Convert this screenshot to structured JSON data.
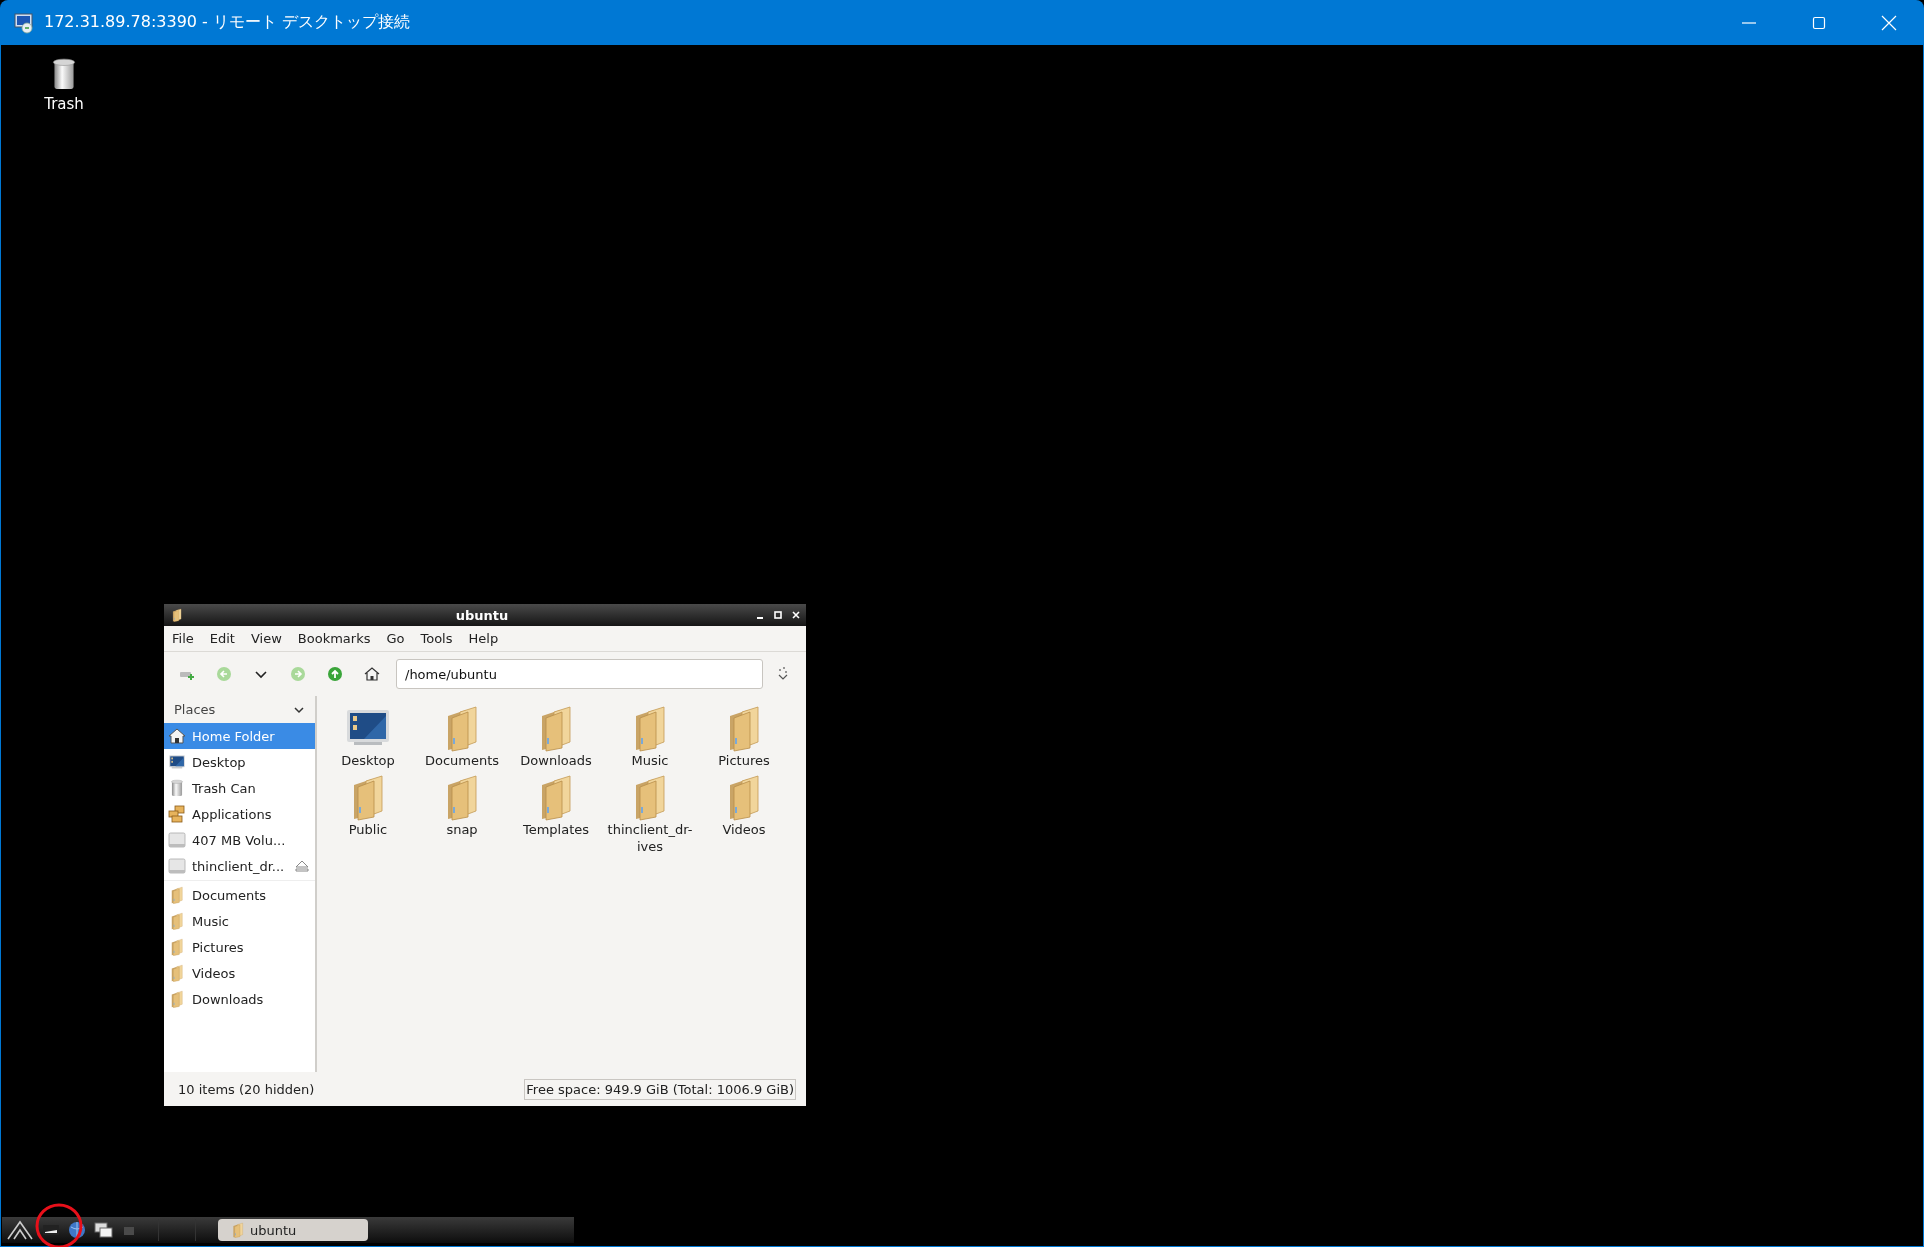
{
  "remote_window": {
    "title": "172.31.89.78:3390 - リモート デスクトップ接続"
  },
  "desktop_icons": [
    {
      "label": "Trash",
      "kind": "trash"
    }
  ],
  "file_manager": {
    "title": "ubuntu",
    "menu": [
      "File",
      "Edit",
      "View",
      "Bookmarks",
      "Go",
      "Tools",
      "Help"
    ],
    "location": "/home/ubuntu",
    "places": {
      "header": "Places",
      "devices": [
        {
          "label": "Home Folder",
          "kind": "home",
          "selected": true,
          "ejectable": false
        },
        {
          "label": "Desktop",
          "kind": "desktop",
          "selected": false,
          "ejectable": false
        },
        {
          "label": "Trash Can",
          "kind": "trash",
          "selected": false,
          "ejectable": false
        },
        {
          "label": "Applications",
          "kind": "apps",
          "selected": false,
          "ejectable": false
        },
        {
          "label": "407 MB Volu...",
          "kind": "drive",
          "selected": false,
          "ejectable": false
        },
        {
          "label": "thinclient_dr...",
          "kind": "drive",
          "selected": false,
          "ejectable": true
        }
      ],
      "bookmarks": [
        {
          "label": "Documents",
          "kind": "folder",
          "selected": false
        },
        {
          "label": "Music",
          "kind": "folder",
          "selected": false
        },
        {
          "label": "Pictures",
          "kind": "folder",
          "selected": false
        },
        {
          "label": "Videos",
          "kind": "folder",
          "selected": false
        },
        {
          "label": "Downloads",
          "kind": "folder",
          "selected": false
        }
      ]
    },
    "files": [
      {
        "name": "Desktop",
        "kind": "desktop"
      },
      {
        "name": "Documents",
        "kind": "folder"
      },
      {
        "name": "Downloads",
        "kind": "folder"
      },
      {
        "name": "Music",
        "kind": "folder"
      },
      {
        "name": "Pictures",
        "kind": "folder"
      },
      {
        "name": "Public",
        "kind": "folder"
      },
      {
        "name": "snap",
        "kind": "folder"
      },
      {
        "name": "Templates",
        "kind": "folder"
      },
      {
        "name": "thinclient_dr-\nives",
        "kind": "folder"
      },
      {
        "name": "Videos",
        "kind": "folder"
      }
    ],
    "status": {
      "count": "10 items (20 hidden)",
      "free_space": "Free space: 949.9 GiB (Total: 1006.9 GiB)"
    }
  },
  "taskbar": {
    "tasks": [
      {
        "label": "ubuntu"
      }
    ]
  }
}
